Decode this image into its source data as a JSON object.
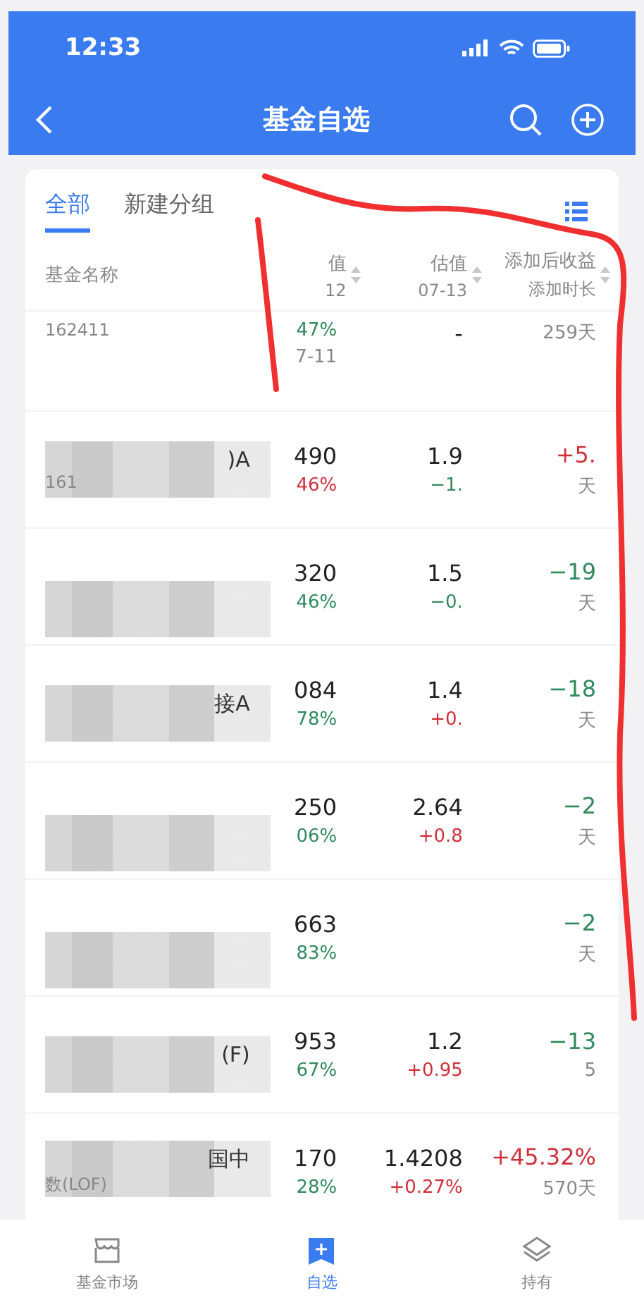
{
  "status_bar": {
    "time": "12:33"
  },
  "header": {
    "title": "基金自选"
  },
  "tabs": [
    {
      "label": "全部",
      "selected": true
    },
    {
      "label": "新建分组",
      "selected": false
    }
  ],
  "columns": {
    "name": "基金名称",
    "nav": "值",
    "nav_date": "12",
    "est": "估值",
    "est_date": "07-13",
    "ret": "添加后收益",
    "days": "添加时长"
  },
  "rows": [
    {
      "code": "162411",
      "nav_pct": "47%",
      "nav_rise": false,
      "nav_date": "7-11",
      "est": "-",
      "days": "259天"
    },
    {
      "name": ")A",
      "code": "161",
      "nav": "490",
      "nav_pct": "46%",
      "nav_rise": true,
      "est": "1.9",
      "est_pct": "−1.",
      "est_rise": false,
      "ret": "+5.",
      "ret_rise": true,
      "days": "天"
    },
    {
      "nav": "320",
      "nav_pct": "46%",
      "nav_rise": false,
      "est": "1.5",
      "est_pct": "−0.",
      "est_rise": false,
      "ret": "−19",
      "ret_rise": false,
      "days": "天"
    },
    {
      "name": "接A",
      "nav": "084",
      "nav_pct": "78%",
      "nav_rise": false,
      "est": "1.4",
      "est_pct": "+0.",
      "est_rise": true,
      "ret": "−18",
      "ret_rise": false,
      "days": "天"
    },
    {
      "nav": "250",
      "nav_pct": "06%",
      "nav_rise": false,
      "est": "2.64",
      "est_pct": "+0.8",
      "est_rise": true,
      "ret": "−2",
      "ret_rise": false,
      "days": "天"
    },
    {
      "nav": "663",
      "nav_pct": "83%",
      "nav_rise": false,
      "ret": "−2",
      "ret_rise": false,
      "days": "天"
    },
    {
      "name": "(F)",
      "nav": "953",
      "nav_pct": "67%",
      "nav_rise": false,
      "est": "1.2",
      "est_pct": "+0.95",
      "est_rise": true,
      "ret": "−13",
      "ret_rise": false,
      "days": "5"
    },
    {
      "name": "国中",
      "code": "数(LOF)",
      "nav": "170",
      "nav_pct": "28%",
      "nav_rise": false,
      "est": "1.4208",
      "est_pct": "+0.27%",
      "est_rise": true,
      "ret": "+45.32%",
      "ret_rise": true,
      "days": "570天"
    }
  ],
  "bottom_nav": [
    {
      "label": "基金市场",
      "kind": "market",
      "selected": false
    },
    {
      "label": "自选",
      "kind": "watchlist",
      "selected": true
    },
    {
      "label": "持有",
      "kind": "holdings",
      "selected": false
    }
  ]
}
